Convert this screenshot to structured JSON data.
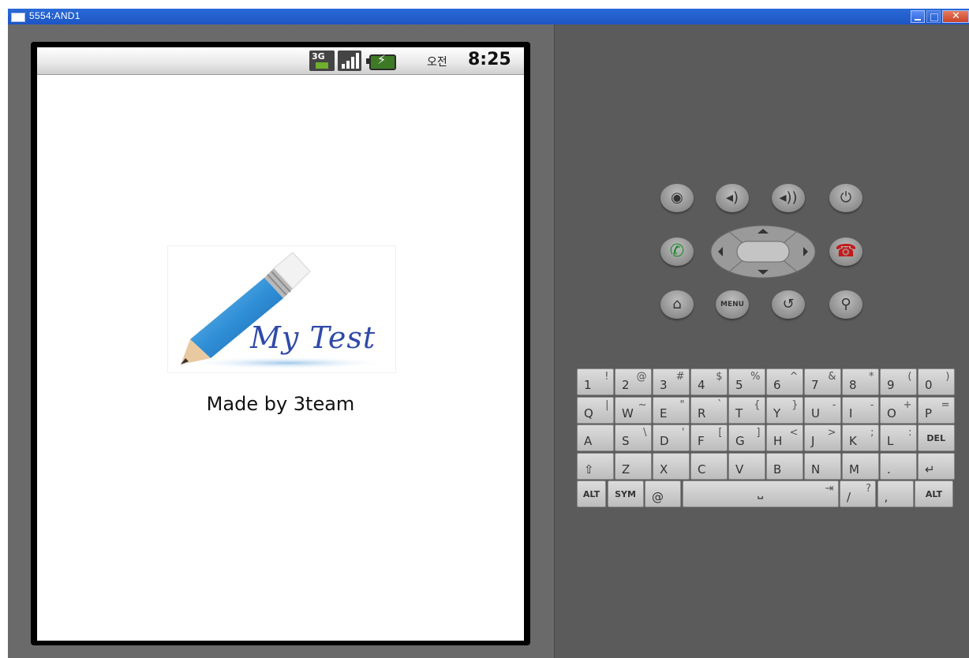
{
  "window": {
    "title": "5554:AND1"
  },
  "status_bar": {
    "network": "3G",
    "ampm": "오전",
    "time": "8:25"
  },
  "app": {
    "logo_text": "My Test",
    "caption": "Made by 3team"
  },
  "controls": {
    "camera": "camera-icon",
    "volume_down": "volume-down-icon",
    "volume_up": "volume-up-icon",
    "power": "power-icon",
    "call": "call-icon",
    "end_call": "end-call-icon",
    "home": "home-icon",
    "menu_label": "MENU",
    "back": "back-icon",
    "search": "search-icon"
  },
  "keyboard": {
    "rows": [
      [
        {
          "main": "1",
          "alt": "!"
        },
        {
          "main": "2",
          "alt": "@"
        },
        {
          "main": "3",
          "alt": "#"
        },
        {
          "main": "4",
          "alt": "$"
        },
        {
          "main": "5",
          "alt": "%"
        },
        {
          "main": "6",
          "alt": "^"
        },
        {
          "main": "7",
          "alt": "&"
        },
        {
          "main": "8",
          "alt": "*"
        },
        {
          "main": "9",
          "alt": "("
        },
        {
          "main": "0",
          "alt": ")"
        }
      ],
      [
        {
          "main": "Q",
          "alt": "|"
        },
        {
          "main": "W",
          "alt": "~"
        },
        {
          "main": "E",
          "alt": "\""
        },
        {
          "main": "R",
          "alt": "`"
        },
        {
          "main": "T",
          "alt": "{"
        },
        {
          "main": "Y",
          "alt": "}"
        },
        {
          "main": "U",
          "alt": "-"
        },
        {
          "main": "I",
          "alt": "-"
        },
        {
          "main": "O",
          "alt": "+"
        },
        {
          "main": "P",
          "alt": "="
        }
      ],
      [
        {
          "main": "A",
          "alt": ""
        },
        {
          "main": "S",
          "alt": "\\"
        },
        {
          "main": "D",
          "alt": "'"
        },
        {
          "main": "F",
          "alt": "["
        },
        {
          "main": "G",
          "alt": "]"
        },
        {
          "main": "H",
          "alt": "<"
        },
        {
          "main": "J",
          "alt": ">"
        },
        {
          "main": "K",
          "alt": ";"
        },
        {
          "main": "L",
          "alt": ":"
        },
        {
          "main": "DEL",
          "alt": ""
        }
      ],
      [
        {
          "main": "⇧",
          "alt": ""
        },
        {
          "main": "Z",
          "alt": ""
        },
        {
          "main": "X",
          "alt": ""
        },
        {
          "main": "C",
          "alt": ""
        },
        {
          "main": "V",
          "alt": ""
        },
        {
          "main": "B",
          "alt": ""
        },
        {
          "main": "N",
          "alt": ""
        },
        {
          "main": "M",
          "alt": ""
        },
        {
          "main": ".",
          "alt": ""
        },
        {
          "main": "↵",
          "alt": ""
        }
      ]
    ],
    "bottom_row": {
      "alt_left": "ALT",
      "sym": "SYM",
      "at": "@",
      "space": "␣",
      "tab": "⇥",
      "slash": "/",
      "slash_alt": "?",
      "comma": ",",
      "alt_right": "ALT"
    }
  }
}
